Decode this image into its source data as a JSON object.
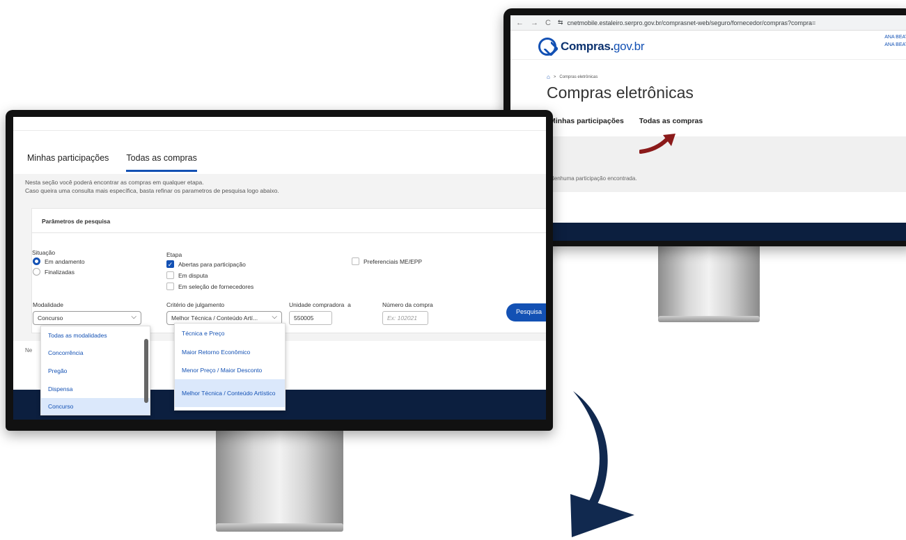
{
  "browser": {
    "url": "cnetmobile.estaleiro.serpro.gov.br/comprasnet-web/seguro/fornecedor/compras?compra=",
    "nav_back": "←",
    "nav_forward": "→",
    "nav_reload": "C",
    "site_info": "⇆"
  },
  "back_screen": {
    "logo_name": "Compras.",
    "logo_domain": "gov.br",
    "user_line_1": "ANA BEATR",
    "user_line_2": "ANA BEATR",
    "breadcrumb_home": "⌂",
    "breadcrumb_sep": ">",
    "breadcrumb_current": "Compras eletrônicas",
    "page_title": "Compras eletrônicas",
    "tabs": [
      "Minhas participações",
      "Todas as compras"
    ],
    "empty_message": "Nenhuma participação encontrada."
  },
  "front_screen": {
    "tabs": [
      "Minhas participações",
      "Todas as compras"
    ],
    "active_tab": "Todas as compras",
    "intro_line_1": "Nesta seção você poderá encontrar as compras em qualquer etapa.",
    "intro_line_2": "Caso queira uma consulta mais específica, basta refinar os parametros de pesquisa logo abaixo.",
    "panel_title": "Parâmetros de pesquisa",
    "situacao_label": "Situação",
    "situacao_options": [
      {
        "label": "Em andamento",
        "checked": true
      },
      {
        "label": "Finalizadas",
        "checked": false
      }
    ],
    "etapa_label": "Etapa",
    "etapa_options": [
      {
        "label": "Abertas para participação",
        "checked": true
      },
      {
        "label": "Em disputa",
        "checked": false
      },
      {
        "label": "Em seleção de fornecedores",
        "checked": false
      }
    ],
    "preferenciais_label": "Preferenciais ME/EPP",
    "modalidade_label": "Modalidade",
    "modalidade_value": "Concurso",
    "criterio_label": "Critério de julgamento",
    "criterio_value": "Melhor Técnica / Conteúdo Artí...",
    "unidade_label": "Unidade compradora",
    "unidade_suffix": "a",
    "unidade_value": "550005",
    "numero_label": "Número da compra",
    "numero_placeholder": "Ex: 102021",
    "search_button": "Pesquisa",
    "partial_text": "Ne",
    "chevron": "⌵",
    "check_mark": "✓",
    "modalidade_options": [
      "Todas as modalidades",
      "Concorrência",
      "Pregão",
      "Dispensa",
      "Concurso"
    ],
    "modalidade_selected": "Concurso",
    "criterio_options": [
      "Técnica e Preço",
      "Maior Retorno Econômico",
      "Menor Preço / Maior Desconto",
      "Melhor Técnica / Conteúdo Artístico"
    ],
    "criterio_selected": "Melhor Técnica / Conteúdo Artístico"
  },
  "colors": {
    "accent": "#1351b4",
    "footer": "#0c1f3f",
    "red_arrow": "#8b1a1a",
    "blue_arrow": "#11294f"
  }
}
